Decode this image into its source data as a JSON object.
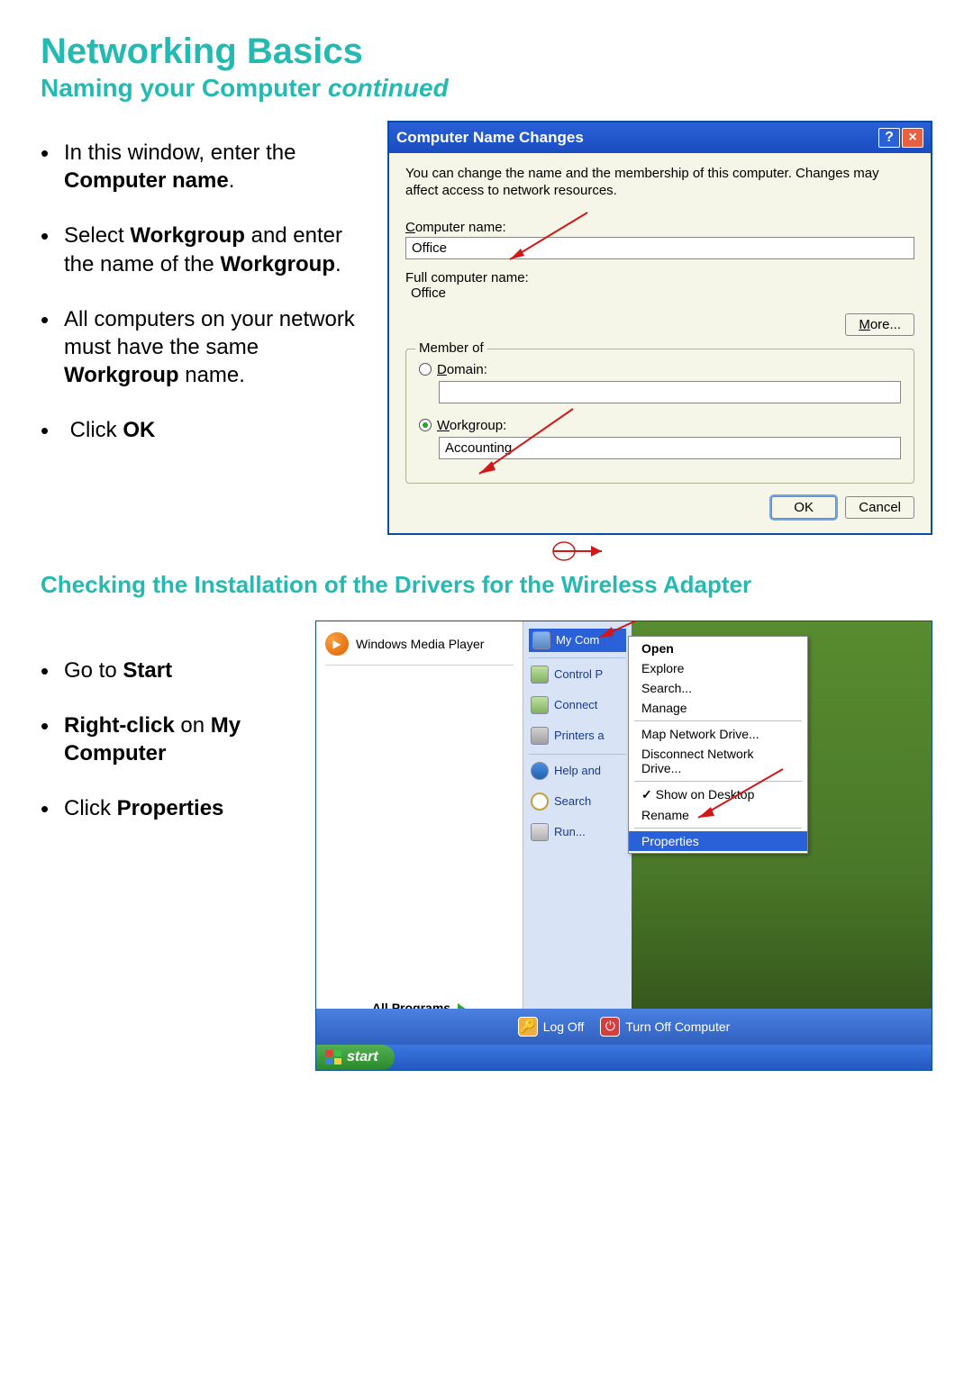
{
  "page_title": "Networking Basics",
  "subtitle_main": "Naming your Computer",
  "subtitle_paren": "continued",
  "section1": {
    "bullets": {
      "b1_a": "In this window, enter the ",
      "b1_bold": "Computer name",
      "b1_c": ".",
      "b2_a": "Select ",
      "b2_bold1": "Workgroup",
      "b2_b": " and enter the name of the ",
      "b2_bold2": "Workgroup",
      "b2_c": ".",
      "b3_a": "All computers on your network must have the same ",
      "b3_bold": "Workgroup",
      "b3_b": " name.",
      "b4_a": "Click ",
      "b4_bold": "OK"
    }
  },
  "dialog": {
    "title": "Computer Name Changes",
    "description": "You can change the name and the membership of this computer. Changes may affect access to network resources.",
    "computer_name_label": "Computer name:",
    "computer_name_value": "Office",
    "full_name_label": "Full computer name:",
    "full_name_value": "Office",
    "more_button": "More...",
    "member_of": "Member of",
    "domain_label": "Domain:",
    "domain_value": "",
    "workgroup_label": "Workgroup:",
    "workgroup_value": "Accounting",
    "ok_button": "OK",
    "cancel_button": "Cancel"
  },
  "section2_heading": "Checking the Installation of the Drivers for the Wireless Adapter",
  "section2": {
    "bullets": {
      "b1_a": "Go to ",
      "b1_bold": "Start",
      "b2_bold1": "Right-click",
      "b2_a": " on ",
      "b2_bold2": "My Computer",
      "b3_a": "Click ",
      "b3_bold": "Properties"
    }
  },
  "startmenu": {
    "left_program": "Windows Media Player",
    "all_programs": "All Programs",
    "right_items": {
      "mycomputer": "My Com",
      "controlpanel": "Control P",
      "connect": "Connect",
      "printers": "Printers a",
      "help": "Help and",
      "search": "Search",
      "run": "Run..."
    },
    "context": {
      "open": "Open",
      "explore": "Explore",
      "search": "Search...",
      "manage": "Manage",
      "map": "Map Network Drive...",
      "disconnect": "Disconnect Network Drive...",
      "showdesk": "Show on Desktop",
      "rename": "Rename",
      "properties": "Properties"
    },
    "bottombar": {
      "logoff": "Log Off",
      "turnoff": "Turn Off Computer"
    },
    "start_button": "start"
  }
}
